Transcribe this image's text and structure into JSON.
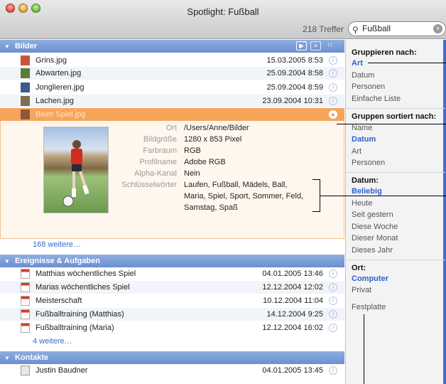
{
  "window": {
    "title": "Spotlight: Fußball",
    "hit_count": "218 Treffer"
  },
  "search": {
    "value": "Fußball"
  },
  "sections": {
    "images": {
      "title": "Bilder"
    },
    "events": {
      "title": "Ereignisse & Aufgaben"
    },
    "contacts": {
      "title": "Kontakte"
    }
  },
  "images": [
    {
      "name": "Grins.jpg",
      "date": "15.03.2005 8:53"
    },
    {
      "name": "Abwarten.jpg",
      "date": "25.09.2004 8:58"
    },
    {
      "name": "Jonglieren.jpg",
      "date": "25.09.2004 8:59"
    },
    {
      "name": "Lachen.jpg",
      "date": "23.09.2004 10:31"
    },
    {
      "name": "Beim Spiel.jpg",
      "date": ""
    }
  ],
  "detail": {
    "labels": [
      "Ort",
      "Bildgröße",
      "Farbraum",
      "Profilname",
      "Alpha-Kanal",
      "Schlüsselwörter"
    ],
    "values": [
      "/Users/Anne/Bilder",
      "1280 x 853 Pixel",
      "RGB",
      "Adobe RGB",
      "Nein",
      "Laufen, Fußball, Mädels, Ball,",
      "Maria, Spiel, Sport, Sommer, Feld,",
      "Samstag, Spaß"
    ]
  },
  "images_more": "168 weitere…",
  "events": [
    {
      "name": "Matthias wöchentliches Spiel",
      "date": "04.01.2005 13:46"
    },
    {
      "name": "Marias wöchentliches Spiel",
      "date": "12.12.2004 12:02"
    },
    {
      "name": "Meisterschaft",
      "date": "10.12.2004 11:04"
    },
    {
      "name": "Fußballtraining (Matthias)",
      "date": "14.12.2004 9:25"
    },
    {
      "name": "Fußballtraining (Maria)",
      "date": "12.12.2004 16:02"
    }
  ],
  "events_more": "4 weitere…",
  "contacts": [
    {
      "name": "Justin Baudner",
      "date": "04.01.2005 13:45"
    }
  ],
  "sidebar": {
    "group_by": {
      "title": "Gruppieren nach:",
      "items": [
        "Art",
        "Datum",
        "Personen",
        "Einfache Liste"
      ],
      "active": "Art"
    },
    "sort_by": {
      "title": "Gruppen sortiert nach:",
      "items": [
        "Name",
        "Datum",
        "Art",
        "Personen"
      ],
      "active": "Datum"
    },
    "date": {
      "title": "Datum:",
      "items": [
        "Beliebig",
        "Heute",
        "Seit gestern",
        "Diese Woche",
        "Dieser Monat",
        "Dieses Jahr"
      ],
      "active": "Beliebig"
    },
    "location": {
      "title": "Ort:",
      "items": [
        "Computer",
        "Privat",
        "Festplatte"
      ],
      "active": "Computer"
    }
  },
  "colors": {
    "section_header": "#6c8fd0",
    "selection": "#f6a55a",
    "link": "#3b6bcf"
  }
}
